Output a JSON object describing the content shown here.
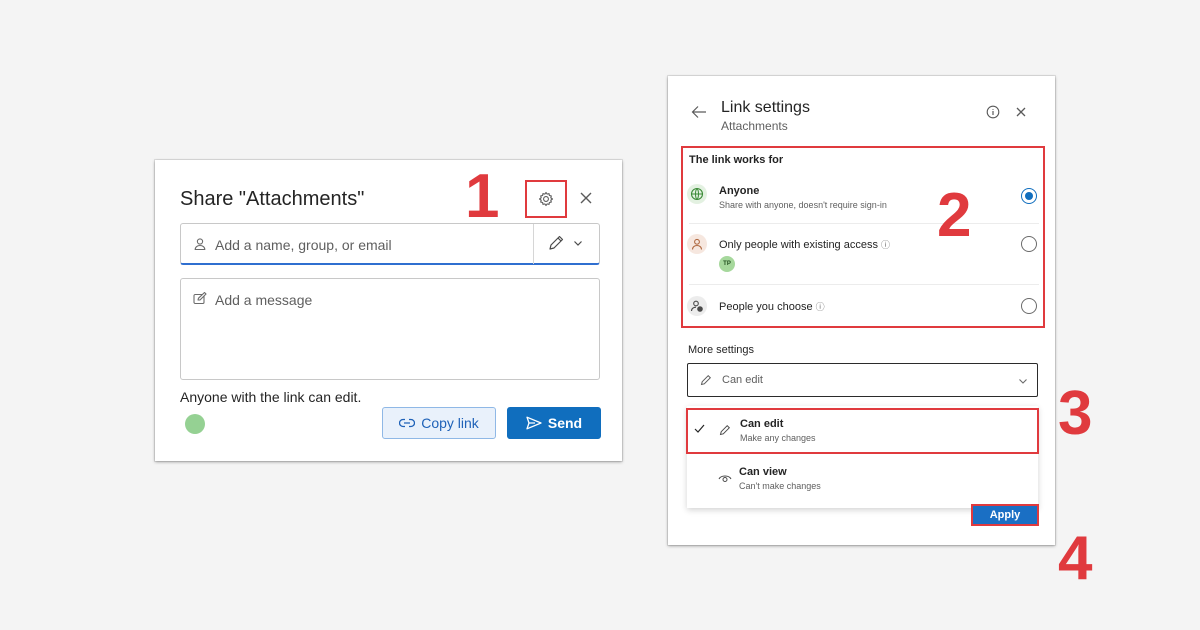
{
  "share_dialog": {
    "title": "Share \"Attachments\"",
    "to_placeholder": "Add a name, group, or email",
    "message_placeholder": "Add a message",
    "status_text": "Anyone with the link can edit.",
    "copy_link_label": "Copy link",
    "send_label": "Send"
  },
  "link_settings": {
    "title": "Link settings",
    "subtitle": "Attachments",
    "works_for_label": "The link works for",
    "options": [
      {
        "label": "Anyone",
        "sublabel": "Share with anyone, doesn't require sign-in",
        "selected": true
      },
      {
        "label": "Only people with existing access",
        "avatar_initials": "TP",
        "selected": false
      },
      {
        "label": "People you choose",
        "selected": false
      }
    ],
    "more_settings_label": "More settings",
    "permission_value": "Can edit",
    "menu": [
      {
        "label": "Can edit",
        "sublabel": "Make any changes",
        "checked": true
      },
      {
        "label": "Can view",
        "sublabel": "Can't make changes",
        "checked": false
      }
    ],
    "apply_label": "Apply"
  },
  "steps": [
    "1",
    "2",
    "3",
    "4"
  ],
  "colors": {
    "accent": "#106ebe",
    "highlight": "#e03a3e",
    "background": "#f4f4f4"
  }
}
